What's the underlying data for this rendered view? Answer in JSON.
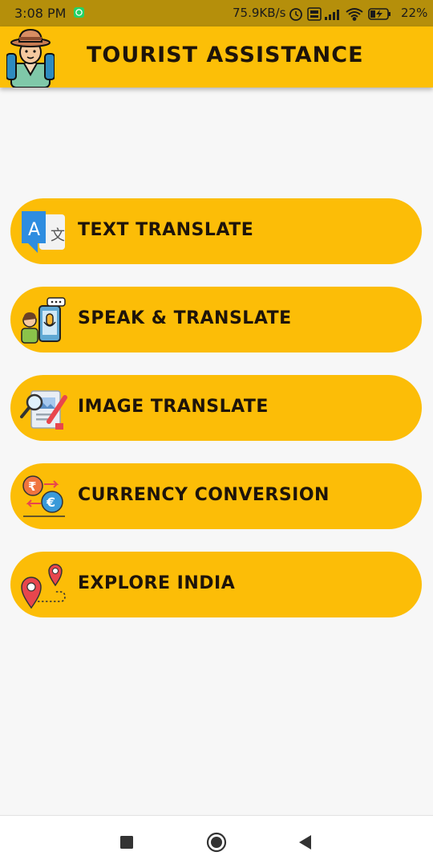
{
  "status_bar": {
    "time": "3:08 PM",
    "network_speed": "75.9KB/s",
    "battery": "22%"
  },
  "app_bar": {
    "title": "TOURIST ASSISTANCE",
    "logo_icon": "tourist-avatar-icon"
  },
  "menu": [
    {
      "label": "TEXT TRANSLATE",
      "icon": "translate-icon"
    },
    {
      "label": "SPEAK & TRANSLATE",
      "icon": "speak-translate-icon"
    },
    {
      "label": "IMAGE TRANSLATE",
      "icon": "image-translate-icon"
    },
    {
      "label": "CURRENCY CONVERSION",
      "icon": "currency-exchange-icon"
    },
    {
      "label": "EXPLORE INDIA",
      "icon": "map-route-icon"
    }
  ],
  "colors": {
    "accent": "#fcbd07",
    "status_bar": "#b58f0b",
    "text_dark": "#1e140a",
    "background": "#f7f7f7"
  },
  "nav_bar": [
    "recents-square-icon",
    "home-circle-icon",
    "back-triangle-icon"
  ]
}
